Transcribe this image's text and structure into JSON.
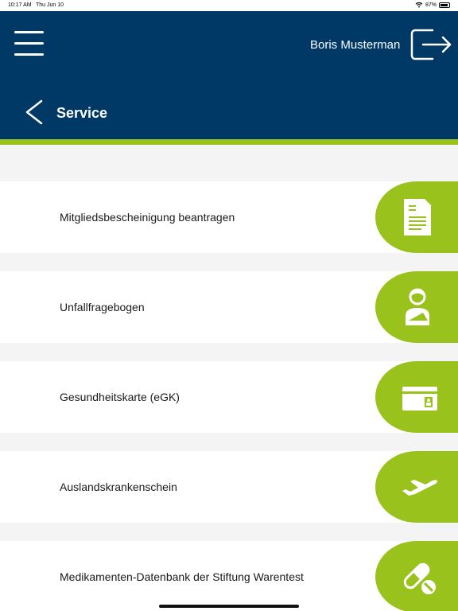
{
  "status_bar": {
    "time": "10:17 AM",
    "date": "Thu Jun 10",
    "battery": "87%"
  },
  "header": {
    "user_name": "Boris Musterman",
    "title": "Service"
  },
  "colors": {
    "header": "#003966",
    "accent": "#99c21c",
    "background": "#f4f4f4"
  },
  "services": [
    {
      "label": "Mitgliedsbescheinigung beantragen",
      "icon": "document-icon"
    },
    {
      "label": "Unfallfragebogen",
      "icon": "injured-person-icon"
    },
    {
      "label": "Gesundheitskarte (eGK)",
      "icon": "health-card-icon"
    },
    {
      "label": "Auslandskrankenschein",
      "icon": "airplane-icon"
    },
    {
      "label": "Medikamenten-Datenbank der Stiftung Warentest",
      "icon": "pills-icon"
    }
  ]
}
